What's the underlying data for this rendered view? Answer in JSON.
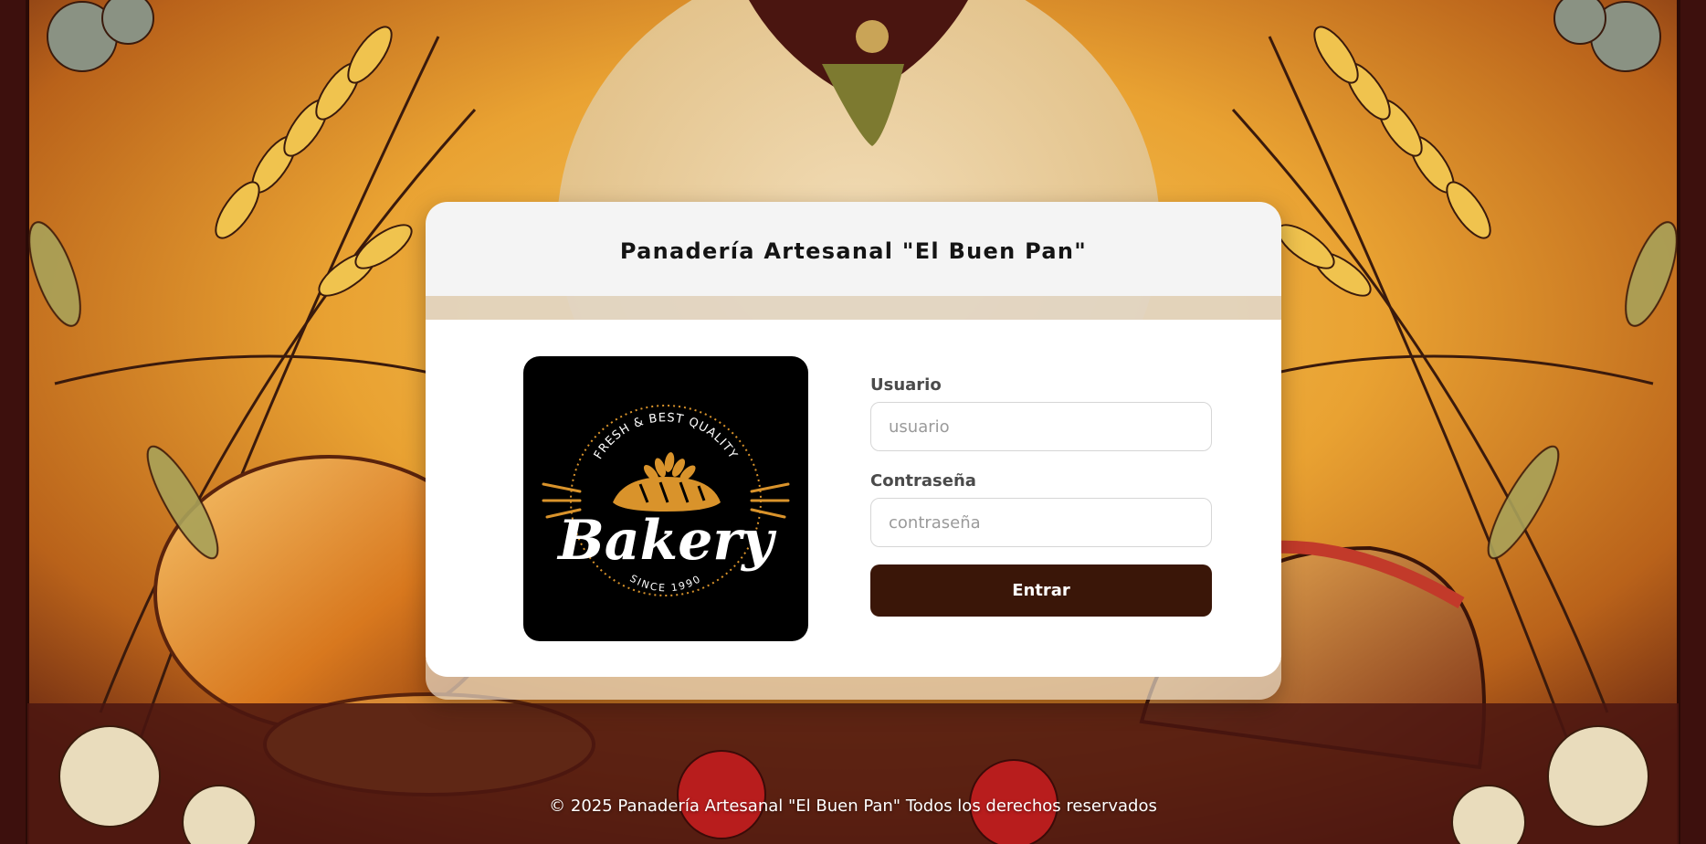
{
  "header": {
    "title": "Panadería Artesanal \"El Buen Pan\""
  },
  "logo": {
    "arc_text": "FRESH & BEST QUALITY",
    "brand": "Bakery",
    "since": "SINCE 1990"
  },
  "login_form": {
    "username": {
      "label": "Usuario",
      "placeholder": "usuario",
      "value": ""
    },
    "password": {
      "label": "Contraseña",
      "placeholder": "contraseña",
      "value": ""
    },
    "submit_label": "Entrar"
  },
  "footer": {
    "text": "© 2025 Panadería Artesanal \"El Buen Pan\" Todos los derechos reservados"
  },
  "colors": {
    "button": "#3a1608",
    "header_bg": "#f4f4f4",
    "logo_bg": "#000000",
    "logo_accent": "#d9932b"
  }
}
